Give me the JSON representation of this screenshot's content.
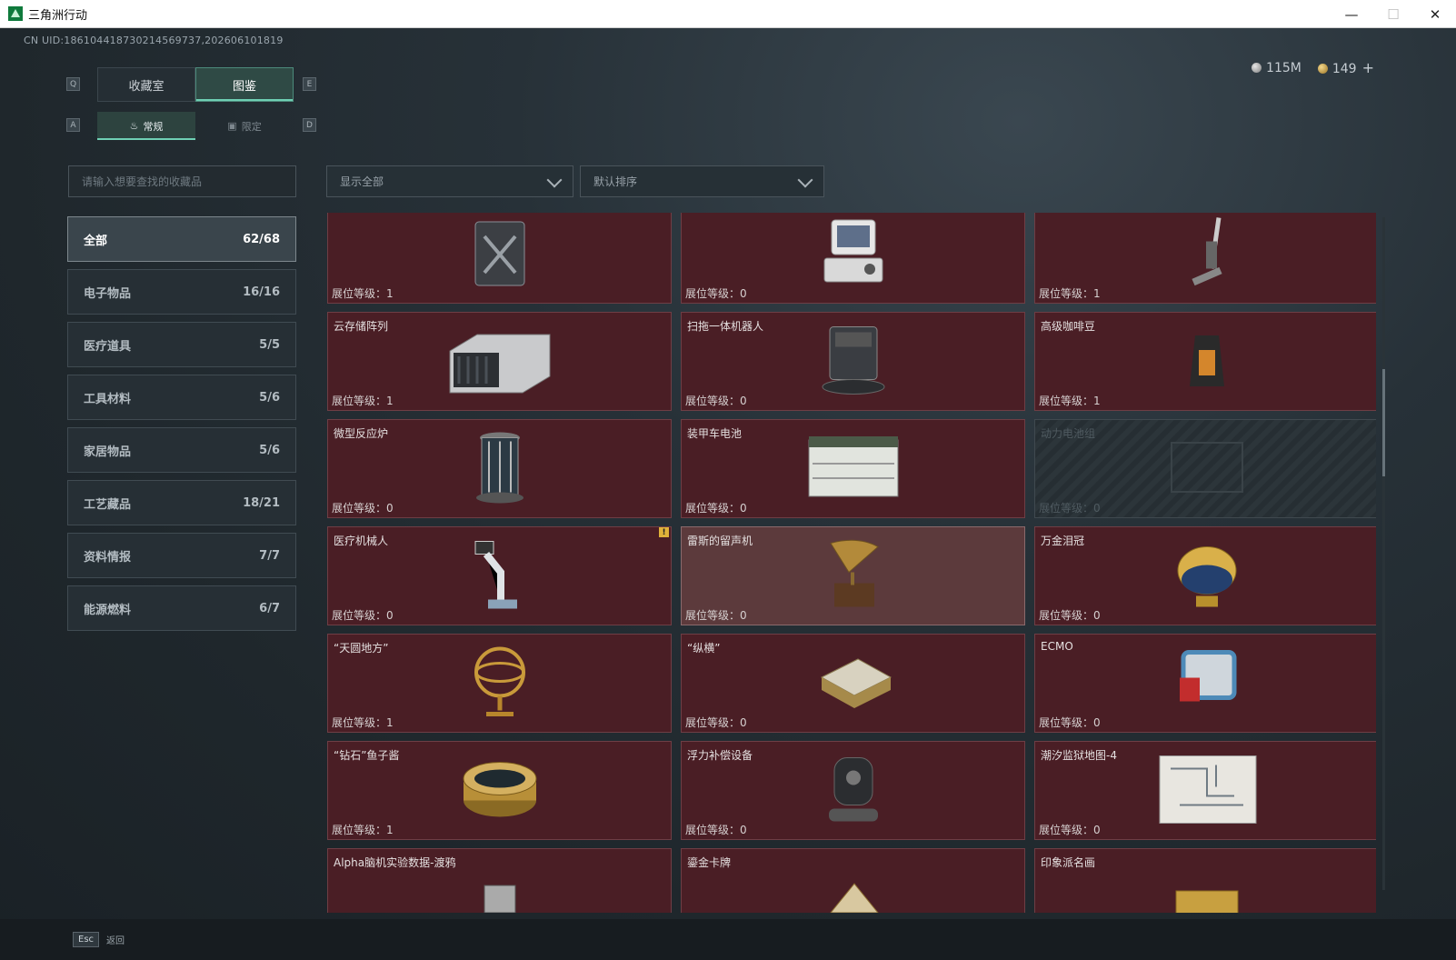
{
  "window": {
    "title": "三角洲行动",
    "minimize": "—",
    "maximize": "☐",
    "close": "✕"
  },
  "uid": "CN UID:186104418730214569737,202606101819",
  "currency": {
    "silver": "115M",
    "gold": "149",
    "plus": "+"
  },
  "keys": {
    "q": "Q",
    "e": "E",
    "a": "A",
    "d": "D",
    "esc": "Esc"
  },
  "main_tabs": [
    {
      "label": "收藏室"
    },
    {
      "label": "图鉴"
    }
  ],
  "sub_tabs": [
    {
      "label": "常规",
      "icon": "♨"
    },
    {
      "label": "限定",
      "icon": "▣"
    }
  ],
  "search": {
    "placeholder": "请输入想要查找的收藏品"
  },
  "filters": {
    "show": "显示全部",
    "sort": "默认排序"
  },
  "categories": [
    {
      "label": "全部",
      "count": "62/68"
    },
    {
      "label": "电子物品",
      "count": "16/16"
    },
    {
      "label": "医疗道具",
      "count": "5/5"
    },
    {
      "label": "工具材料",
      "count": "5/6"
    },
    {
      "label": "家居物品",
      "count": "5/6"
    },
    {
      "label": "工艺藏品",
      "count": "18/21"
    },
    {
      "label": "资料情报",
      "count": "7/7"
    },
    {
      "label": "能源燃料",
      "count": "6/7"
    }
  ],
  "level_prefix": "展位等级：",
  "items": [
    {
      "name": "",
      "level": "1",
      "icon": "jerrycan-icon"
    },
    {
      "name": "",
      "level": "0",
      "icon": "computer-icon"
    },
    {
      "name": "",
      "level": "1",
      "icon": "vacuum-icon"
    },
    {
      "name": "云存储阵列",
      "level": "1",
      "icon": "storage-array-icon"
    },
    {
      "name": "扫拖一体机器人",
      "level": "0",
      "icon": "robot-vacuum-icon"
    },
    {
      "name": "高级咖啡豆",
      "level": "1",
      "icon": "coffee-bag-icon"
    },
    {
      "name": "微型反应炉",
      "level": "0",
      "icon": "reactor-icon"
    },
    {
      "name": "装甲车电池",
      "level": "0",
      "icon": "battery-icon"
    },
    {
      "name": "动力电池组",
      "level": "0",
      "icon": "battery-pack-icon"
    },
    {
      "name": "医疗机械人",
      "level": "0",
      "icon": "medical-robot-icon",
      "badge": "!"
    },
    {
      "name": "雷斯的留声机",
      "level": "0",
      "icon": "gramophone-icon"
    },
    {
      "name": "万金泪冠",
      "level": "0",
      "icon": "jeweled-egg-icon"
    },
    {
      "name": "“天圆地方”",
      "level": "1",
      "icon": "armillary-icon"
    },
    {
      "name": "“纵横”",
      "level": "0",
      "icon": "chessboard-icon"
    },
    {
      "name": "ECMO",
      "level": "0",
      "icon": "ecmo-icon"
    },
    {
      "name": "“钻石”鱼子酱",
      "level": "1",
      "icon": "caviar-icon"
    },
    {
      "name": "浮力补偿设备",
      "level": "0",
      "icon": "buoyancy-icon"
    },
    {
      "name": "潮汐监狱地图-4",
      "level": "0",
      "icon": "map-icon"
    },
    {
      "name": "Alpha脑机实验数据-渡鸦",
      "level": "",
      "icon": "data-drive-icon"
    },
    {
      "name": "鎏金卡牌",
      "level": "",
      "icon": "card-icon"
    },
    {
      "name": "印象派名画",
      "level": "",
      "icon": "painting-icon"
    }
  ],
  "bottom": {
    "back": "返回"
  }
}
